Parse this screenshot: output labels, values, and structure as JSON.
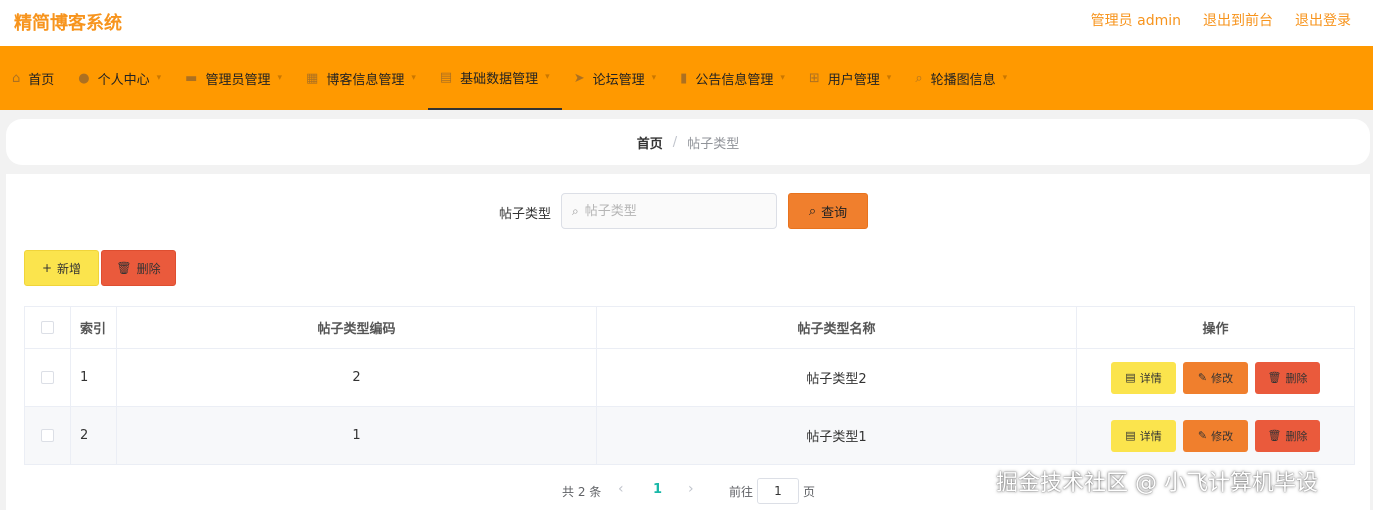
{
  "app": {
    "title": "精简博客系统",
    "user_label": "管理员 admin",
    "exit_front": "退出到前台",
    "logout": "退出登录"
  },
  "nav": {
    "items": [
      {
        "label": "首页",
        "icon": "home-icon",
        "glyph": "⌂",
        "has_arrow": false
      },
      {
        "label": "个人中心",
        "icon": "user-icon",
        "glyph": "●",
        "has_arrow": true
      },
      {
        "label": "管理员管理",
        "icon": "chat-icon",
        "glyph": "▬",
        "has_arrow": true
      },
      {
        "label": "博客信息管理",
        "icon": "grid-icon",
        "glyph": "▦",
        "has_arrow": true
      },
      {
        "label": "基础数据管理",
        "icon": "shop-icon",
        "glyph": "▤",
        "has_arrow": true,
        "active": true
      },
      {
        "label": "论坛管理",
        "icon": "send-icon",
        "glyph": "➤",
        "has_arrow": true
      },
      {
        "label": "公告信息管理",
        "icon": "document-icon",
        "glyph": "▮",
        "has_arrow": true
      },
      {
        "label": "用户管理",
        "icon": "cart-icon",
        "glyph": "⊞",
        "has_arrow": true
      },
      {
        "label": "轮播图信息",
        "icon": "search-icon",
        "glyph": "⌕",
        "has_arrow": true
      }
    ]
  },
  "breadcrumb": {
    "home": "首页",
    "separator": "/",
    "current": "帖子类型"
  },
  "search": {
    "label": "帖子类型",
    "placeholder": "帖子类型",
    "button": "查询"
  },
  "actions": {
    "add": "新增",
    "delete": "删除"
  },
  "table": {
    "columns": [
      "索引",
      "帖子类型编码",
      "帖子类型名称",
      "操作"
    ],
    "rows": [
      {
        "index": "1",
        "code": "2",
        "name": "帖子类型2"
      },
      {
        "index": "2",
        "code": "1",
        "name": "帖子类型1"
      }
    ],
    "row_actions": {
      "detail": "详情",
      "edit": "修改",
      "delete": "删除"
    }
  },
  "pagination": {
    "total": "共 2 条",
    "current_page": "1",
    "goto_label": "前往",
    "goto_value": "1",
    "page_unit": "页"
  },
  "watermark": "掘金技术社区 @ 小飞计算机毕设",
  "colors": {
    "brand": "#f7941d",
    "nav_bg": "#ff9900",
    "yellow_button": "#fbe44d",
    "orange_button": "#f07f2d",
    "red_button": "#ea5a3c",
    "active_page": "#19b8a8"
  }
}
